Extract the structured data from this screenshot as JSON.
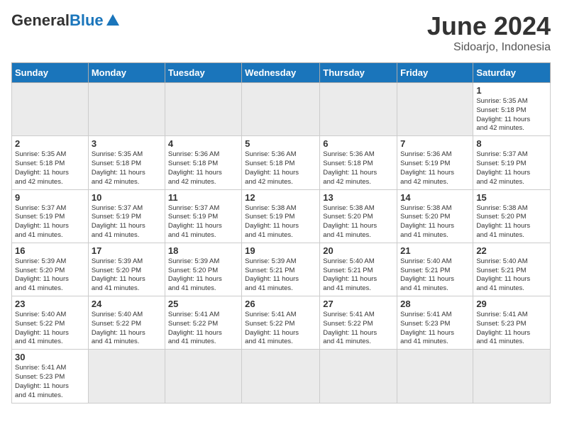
{
  "header": {
    "logo_general": "General",
    "logo_blue": "Blue",
    "month_year": "June 2024",
    "location": "Sidoarjo, Indonesia"
  },
  "days_of_week": [
    "Sunday",
    "Monday",
    "Tuesday",
    "Wednesday",
    "Thursday",
    "Friday",
    "Saturday"
  ],
  "weeks": [
    [
      {
        "day": "",
        "info": ""
      },
      {
        "day": "",
        "info": ""
      },
      {
        "day": "",
        "info": ""
      },
      {
        "day": "",
        "info": ""
      },
      {
        "day": "",
        "info": ""
      },
      {
        "day": "",
        "info": ""
      },
      {
        "day": "1",
        "info": "Sunrise: 5:35 AM\nSunset: 5:18 PM\nDaylight: 11 hours\nand 42 minutes."
      }
    ],
    [
      {
        "day": "2",
        "info": "Sunrise: 5:35 AM\nSunset: 5:18 PM\nDaylight: 11 hours\nand 42 minutes."
      },
      {
        "day": "3",
        "info": "Sunrise: 5:35 AM\nSunset: 5:18 PM\nDaylight: 11 hours\nand 42 minutes."
      },
      {
        "day": "4",
        "info": "Sunrise: 5:36 AM\nSunset: 5:18 PM\nDaylight: 11 hours\nand 42 minutes."
      },
      {
        "day": "5",
        "info": "Sunrise: 5:36 AM\nSunset: 5:18 PM\nDaylight: 11 hours\nand 42 minutes."
      },
      {
        "day": "6",
        "info": "Sunrise: 5:36 AM\nSunset: 5:18 PM\nDaylight: 11 hours\nand 42 minutes."
      },
      {
        "day": "7",
        "info": "Sunrise: 5:36 AM\nSunset: 5:19 PM\nDaylight: 11 hours\nand 42 minutes."
      },
      {
        "day": "8",
        "info": "Sunrise: 5:37 AM\nSunset: 5:19 PM\nDaylight: 11 hours\nand 42 minutes."
      }
    ],
    [
      {
        "day": "9",
        "info": "Sunrise: 5:37 AM\nSunset: 5:19 PM\nDaylight: 11 hours\nand 41 minutes."
      },
      {
        "day": "10",
        "info": "Sunrise: 5:37 AM\nSunset: 5:19 PM\nDaylight: 11 hours\nand 41 minutes."
      },
      {
        "day": "11",
        "info": "Sunrise: 5:37 AM\nSunset: 5:19 PM\nDaylight: 11 hours\nand 41 minutes."
      },
      {
        "day": "12",
        "info": "Sunrise: 5:38 AM\nSunset: 5:19 PM\nDaylight: 11 hours\nand 41 minutes."
      },
      {
        "day": "13",
        "info": "Sunrise: 5:38 AM\nSunset: 5:20 PM\nDaylight: 11 hours\nand 41 minutes."
      },
      {
        "day": "14",
        "info": "Sunrise: 5:38 AM\nSunset: 5:20 PM\nDaylight: 11 hours\nand 41 minutes."
      },
      {
        "day": "15",
        "info": "Sunrise: 5:38 AM\nSunset: 5:20 PM\nDaylight: 11 hours\nand 41 minutes."
      }
    ],
    [
      {
        "day": "16",
        "info": "Sunrise: 5:39 AM\nSunset: 5:20 PM\nDaylight: 11 hours\nand 41 minutes."
      },
      {
        "day": "17",
        "info": "Sunrise: 5:39 AM\nSunset: 5:20 PM\nDaylight: 11 hours\nand 41 minutes."
      },
      {
        "day": "18",
        "info": "Sunrise: 5:39 AM\nSunset: 5:20 PM\nDaylight: 11 hours\nand 41 minutes."
      },
      {
        "day": "19",
        "info": "Sunrise: 5:39 AM\nSunset: 5:21 PM\nDaylight: 11 hours\nand 41 minutes."
      },
      {
        "day": "20",
        "info": "Sunrise: 5:40 AM\nSunset: 5:21 PM\nDaylight: 11 hours\nand 41 minutes."
      },
      {
        "day": "21",
        "info": "Sunrise: 5:40 AM\nSunset: 5:21 PM\nDaylight: 11 hours\nand 41 minutes."
      },
      {
        "day": "22",
        "info": "Sunrise: 5:40 AM\nSunset: 5:21 PM\nDaylight: 11 hours\nand 41 minutes."
      }
    ],
    [
      {
        "day": "23",
        "info": "Sunrise: 5:40 AM\nSunset: 5:22 PM\nDaylight: 11 hours\nand 41 minutes."
      },
      {
        "day": "24",
        "info": "Sunrise: 5:40 AM\nSunset: 5:22 PM\nDaylight: 11 hours\nand 41 minutes."
      },
      {
        "day": "25",
        "info": "Sunrise: 5:41 AM\nSunset: 5:22 PM\nDaylight: 11 hours\nand 41 minutes."
      },
      {
        "day": "26",
        "info": "Sunrise: 5:41 AM\nSunset: 5:22 PM\nDaylight: 11 hours\nand 41 minutes."
      },
      {
        "day": "27",
        "info": "Sunrise: 5:41 AM\nSunset: 5:22 PM\nDaylight: 11 hours\nand 41 minutes."
      },
      {
        "day": "28",
        "info": "Sunrise: 5:41 AM\nSunset: 5:23 PM\nDaylight: 11 hours\nand 41 minutes."
      },
      {
        "day": "29",
        "info": "Sunrise: 5:41 AM\nSunset: 5:23 PM\nDaylight: 11 hours\nand 41 minutes."
      }
    ],
    [
      {
        "day": "30",
        "info": "Sunrise: 5:41 AM\nSunset: 5:23 PM\nDaylight: 11 hours\nand 41 minutes."
      },
      {
        "day": "",
        "info": ""
      },
      {
        "day": "",
        "info": ""
      },
      {
        "day": "",
        "info": ""
      },
      {
        "day": "",
        "info": ""
      },
      {
        "day": "",
        "info": ""
      },
      {
        "day": "",
        "info": ""
      }
    ]
  ]
}
